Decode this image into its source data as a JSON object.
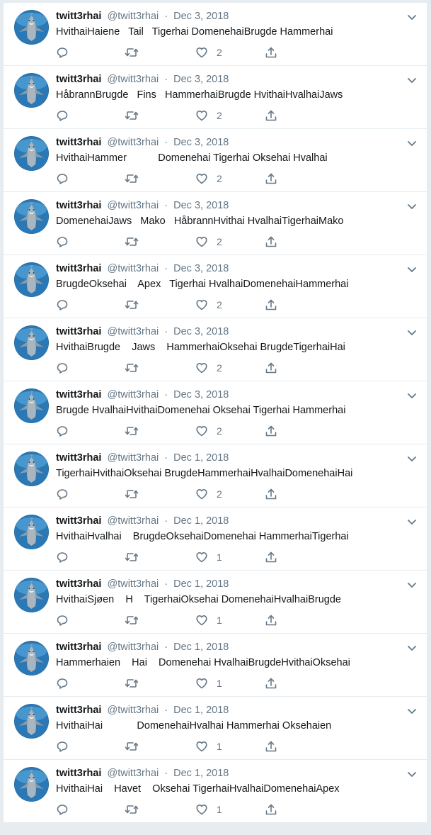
{
  "tweets": [
    {
      "username": "twitt3rhai",
      "handle": "@twitt3rhai",
      "separator": "·",
      "date": "Dec 3, 2018",
      "text": "HvithaiHaiene   Tail   Tigerhai DomenehaiBrugde Hammerhai",
      "likes": "2"
    },
    {
      "username": "twitt3rhai",
      "handle": "@twitt3rhai",
      "separator": "·",
      "date": "Dec 3, 2018",
      "text": "HåbrannBrugde   Fins   HammerhaiBrugde HvithaiHvalhaiJaws",
      "likes": "2"
    },
    {
      "username": "twitt3rhai",
      "handle": "@twitt3rhai",
      "separator": "·",
      "date": "Dec 3, 2018",
      "text": "HvithaiHammer           Domenehai Tigerhai Oksehai Hvalhai",
      "likes": "2"
    },
    {
      "username": "twitt3rhai",
      "handle": "@twitt3rhai",
      "separator": "·",
      "date": "Dec 3, 2018",
      "text": "DomenehaiJaws   Mako   HåbrannHvithai HvalhaiTigerhaiMako",
      "likes": "2"
    },
    {
      "username": "twitt3rhai",
      "handle": "@twitt3rhai",
      "separator": "·",
      "date": "Dec 3, 2018",
      "text": "BrugdeOksehai    Apex   Tigerhai HvalhaiDomenehaiHammerhai",
      "likes": "2"
    },
    {
      "username": "twitt3rhai",
      "handle": "@twitt3rhai",
      "separator": "·",
      "date": "Dec 3, 2018",
      "text": "HvithaiBrugde    Jaws    HammerhaiOksehai BrugdeTigerhaiHai",
      "likes": "2"
    },
    {
      "username": "twitt3rhai",
      "handle": "@twitt3rhai",
      "separator": "·",
      "date": "Dec 3, 2018",
      "text": "Brugde HvalhaiHvithaiDomenehai Oksehai Tigerhai Hammerhai",
      "likes": "2"
    },
    {
      "username": "twitt3rhai",
      "handle": "@twitt3rhai",
      "separator": "·",
      "date": "Dec 1, 2018",
      "text": "TigerhaiHvithaiOksehai BrugdeHammerhaiHvalhaiDomenehaiHai",
      "likes": "2"
    },
    {
      "username": "twitt3rhai",
      "handle": "@twitt3rhai",
      "separator": "·",
      "date": "Dec 1, 2018",
      "text": "HvithaiHvalhai    BrugdeOksehaiDomenehai HammerhaiTigerhai",
      "likes": "1"
    },
    {
      "username": "twitt3rhai",
      "handle": "@twitt3rhai",
      "separator": "·",
      "date": "Dec 1, 2018",
      "text": "HvithaiSjøen    H    TigerhaiOksehai DomenehaiHvalhaiBrugde",
      "likes": "1"
    },
    {
      "username": "twitt3rhai",
      "handle": "@twitt3rhai",
      "separator": "·",
      "date": "Dec 1, 2018",
      "text": "Hammerhaien    Hai    Domenehai HvalhaiBrugdeHvithaiOksehai",
      "likes": "1"
    },
    {
      "username": "twitt3rhai",
      "handle": "@twitt3rhai",
      "separator": "·",
      "date": "Dec 1, 2018",
      "text": "HvithaiHai            DomenehaiHvalhai Hammerhai Oksehaien",
      "likes": "1"
    },
    {
      "username": "twitt3rhai",
      "handle": "@twitt3rhai",
      "separator": "·",
      "date": "Dec 1, 2018",
      "text": "HvithaiHai    Havet    Oksehai TigerhaiHvalhaiDomenehaiApex",
      "likes": "1"
    }
  ],
  "icons": {
    "avatar": "shark-avatar-icon",
    "caret": "chevron-down-icon",
    "reply": "reply-icon",
    "retweet": "retweet-icon",
    "like": "heart-icon",
    "share": "share-icon"
  },
  "colors": {
    "background": "#e6ecf0",
    "card": "#ffffff",
    "text": "#14171a",
    "muted": "#657786",
    "border": "#e6ecf0"
  }
}
